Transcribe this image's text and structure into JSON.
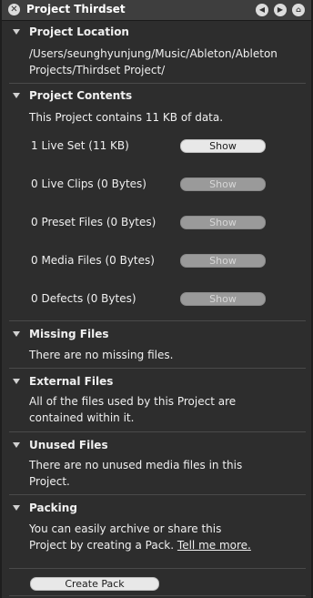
{
  "window": {
    "title": "Project Thirdset",
    "close_glyph": "✕",
    "back_glyph": "◀",
    "forward_glyph": "▶",
    "home_glyph": "⌂"
  },
  "project_location": {
    "header": "Project Location",
    "path_line1": "/Users/seunghyunjung/Music/Ableton/Ableton",
    "path_line2": "Projects/Thirdset Project/"
  },
  "project_contents": {
    "header": "Project Contents",
    "summary": "This Project contains 11 KB of data.",
    "show_label": "Show",
    "rows": [
      {
        "label": "1 Live Set (11 KB)",
        "enabled": true
      },
      {
        "label": "0 Live Clips (0 Bytes)",
        "enabled": false
      },
      {
        "label": "0 Preset Files (0 Bytes)",
        "enabled": false
      },
      {
        "label": "0 Media Files (0 Bytes)",
        "enabled": false
      },
      {
        "label": "0 Defects (0 Bytes)",
        "enabled": false
      }
    ]
  },
  "missing_files": {
    "header": "Missing Files",
    "text": "There are no missing files."
  },
  "external_files": {
    "header": "External Files",
    "line1": "All of the files used by this Project are",
    "line2": "contained within it."
  },
  "unused_files": {
    "header": "Unused Files",
    "line1": "There are no unused media files in this",
    "line2": "Project."
  },
  "packing": {
    "header": "Packing",
    "line1": "You can easily archive or share this",
    "line2_text": "Project by creating a Pack.",
    "link_text": "Tell me more.",
    "button": "Create Pack"
  },
  "icons": {
    "close": "close-icon",
    "back": "back-arrow-icon",
    "forward": "forward-arrow-icon",
    "home": "home-icon",
    "disclosure": "disclosure-triangle-icon"
  }
}
